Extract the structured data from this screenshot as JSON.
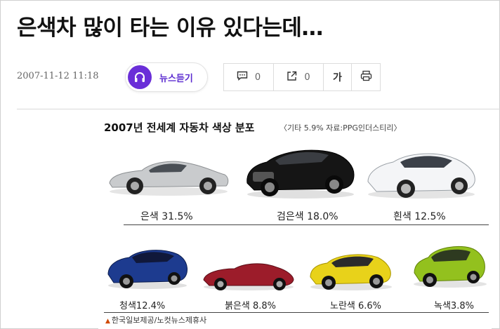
{
  "article": {
    "headline": "은색차 많이 타는 이유 있다는데…",
    "date": "2007-11-12 11:18"
  },
  "toolbar": {
    "listen_label": "뉴스듣기",
    "comment_count": "0",
    "share_count": "0",
    "font_size_glyph": "가"
  },
  "figure": {
    "title": "2007년 전세계 자동차 색상 분포",
    "note": "〈기타 5.9% 자료:PPG인더스티리〉",
    "top_row": [
      {
        "label": "은색 31.5%",
        "color": "silver"
      },
      {
        "label": "검은색 18.0%",
        "color": "black"
      },
      {
        "label": "흰색 12.5%",
        "color": "white"
      }
    ],
    "bottom_row": [
      {
        "label": "청색12.4%",
        "color": "blue"
      },
      {
        "label": "붉은색 8.8%",
        "color": "red"
      },
      {
        "label": "노란색 6.6%",
        "color": "yellow"
      },
      {
        "label": "녹색3.8%",
        "color": "green"
      }
    ],
    "credit": "한국일보제공/노컷뉴스제휴사"
  },
  "icons": {
    "listen": "headphones-icon",
    "comment": "comment-icon",
    "share": "share-icon",
    "print": "printer-icon"
  },
  "colors": {
    "listen_accent": "#6a2ed8",
    "credit_arrow": "#d04a02"
  }
}
